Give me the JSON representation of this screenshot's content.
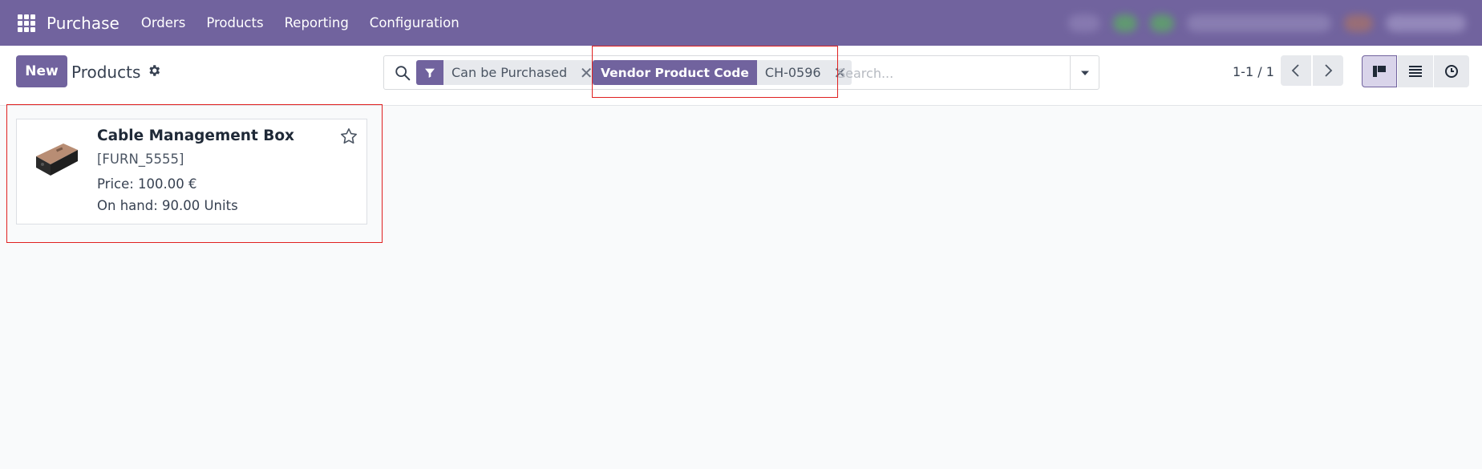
{
  "navbar": {
    "app_name": "Purchase",
    "menu": [
      "Orders",
      "Products",
      "Reporting",
      "Configuration"
    ]
  },
  "control_panel": {
    "new_label": "New",
    "title": "Products"
  },
  "search": {
    "facets": [
      {
        "category_icon": "filter-icon",
        "value": "Can be Purchased"
      },
      {
        "category": "Vendor Product Code",
        "value": "CH-0596"
      }
    ],
    "placeholder": "Search..."
  },
  "pager": {
    "value": "1-1 / 1"
  },
  "views": [
    "kanban",
    "list",
    "activity"
  ],
  "records": [
    {
      "name": "Cable Management Box",
      "reference": "[FURN_5555]",
      "price": "Price: 100.00 €",
      "on_hand": "On hand: 90.00 Units"
    }
  ],
  "colors": {
    "brand": "#71639e",
    "highlight": "#e02020"
  }
}
